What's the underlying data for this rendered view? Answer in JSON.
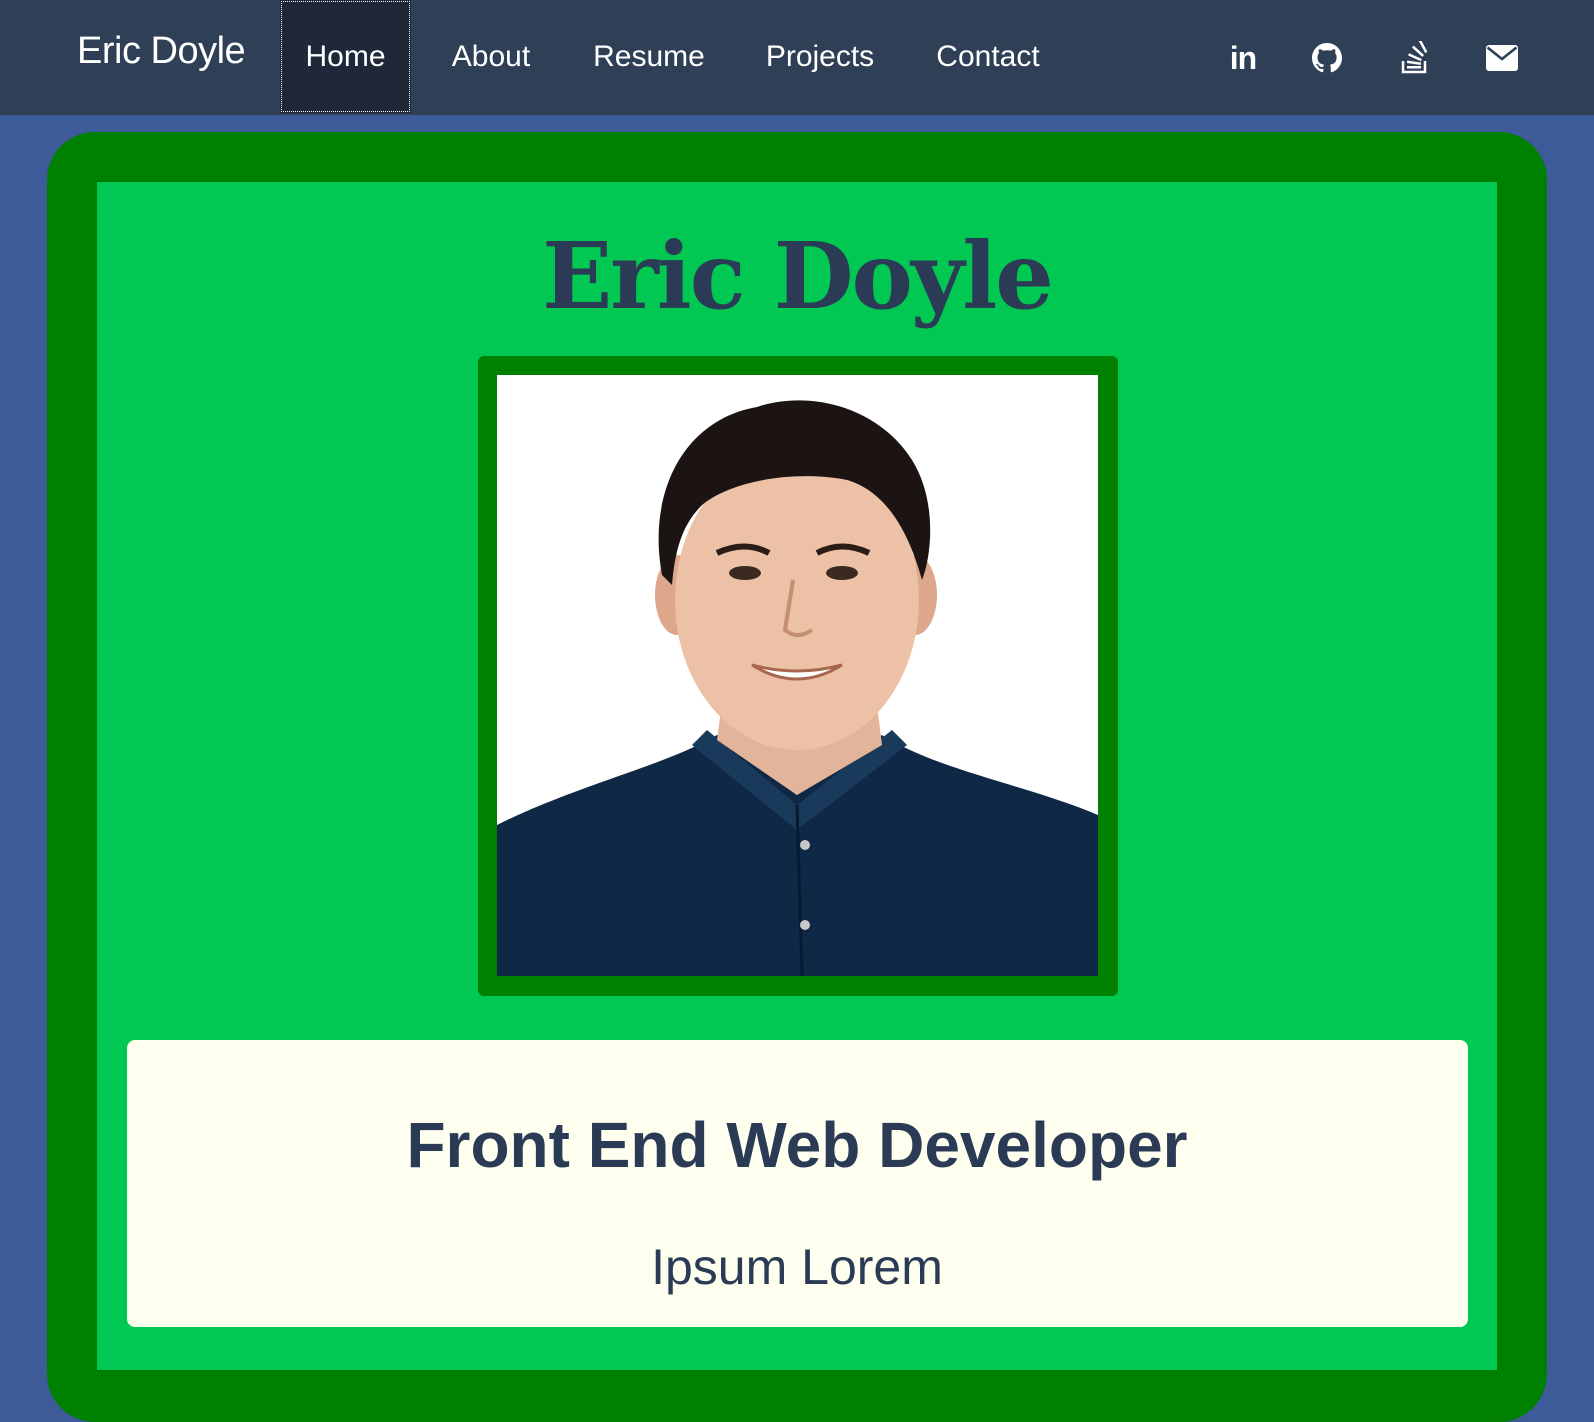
{
  "navbar": {
    "brand": "Eric Doyle",
    "items": [
      {
        "label": "Home",
        "active": true
      },
      {
        "label": "About",
        "active": false
      },
      {
        "label": "Resume",
        "active": false
      },
      {
        "label": "Projects",
        "active": false
      },
      {
        "label": "Contact",
        "active": false
      }
    ],
    "social": [
      {
        "icon": "linkedin-icon",
        "glyph": "in"
      },
      {
        "icon": "github-icon"
      },
      {
        "icon": "stack-overflow-icon"
      },
      {
        "icon": "envelope-icon"
      }
    ]
  },
  "hero": {
    "name": "Eric Doyle",
    "photo_alt": "Eric Doyle",
    "title": "Front End Web Developer",
    "subtitle": "Ipsum Lorem"
  },
  "colors": {
    "navbar_bg": "#2f3f55",
    "active_nav_bg": "#1e2838",
    "page_bg": "#3d5a99",
    "card_outer": "#008000",
    "card_inner": "#00c853",
    "tagline_bg": "#fffff0",
    "text_dark": "#2b3a55"
  }
}
